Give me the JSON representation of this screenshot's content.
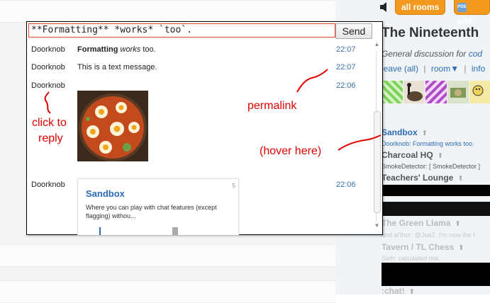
{
  "topbar": {
    "all_rooms": "all rooms",
    "site": "site",
    "site_badge": "POE"
  },
  "room": {
    "title": "The Nineteenth",
    "desc_prefix": "General discussion for ",
    "desc_link": "cod",
    "leave": "leave",
    "leave_all": "all",
    "room_menu": "room▼",
    "info": "info"
  },
  "rooms": [
    {
      "name": "Sandbox",
      "last": "Doorknob: Formatting works too."
    },
    {
      "name": "Charcoal HQ",
      "last": "SmokeDetector: [ SmokeDetector ]"
    },
    {
      "name": "Teachers' Lounge",
      "last": ""
    },
    {
      "name": "The Green Llama",
      "last": "and al'thor: @JoeZ. I'm now the f"
    },
    {
      "name": "Tavern / TL Chess",
      "last": "Seth: calculated risk."
    },
    {
      "name": ":chat!",
      "last": ""
    }
  ],
  "chat": {
    "input_value": "**Formatting** *works* `too`.",
    "send_label": "Send",
    "messages": [
      {
        "user": "Doorknob",
        "bold": "Formatting",
        "italic": "works",
        "rest": "too.",
        "time": "22:07"
      },
      {
        "user": "Doorknob",
        "text": "This is a text message.",
        "time": "22:07"
      },
      {
        "user": "Doorknob",
        "text": "",
        "time": "22:06"
      },
      {
        "user": "Doorknob",
        "text": "",
        "time": "22:06"
      }
    ],
    "onebox": {
      "count": "5",
      "title": "Sandbox",
      "desc": "Where you can play with chat features (except flagging) withou..."
    }
  },
  "annotations": {
    "permalink": "permalink",
    "click_to": "click to",
    "reply": "reply",
    "hover_here": "(hover here)"
  },
  "colors": {
    "accent_orange": "#f39a1e",
    "link_blue": "#2b6cb5",
    "annotation_red": "#e00000"
  }
}
